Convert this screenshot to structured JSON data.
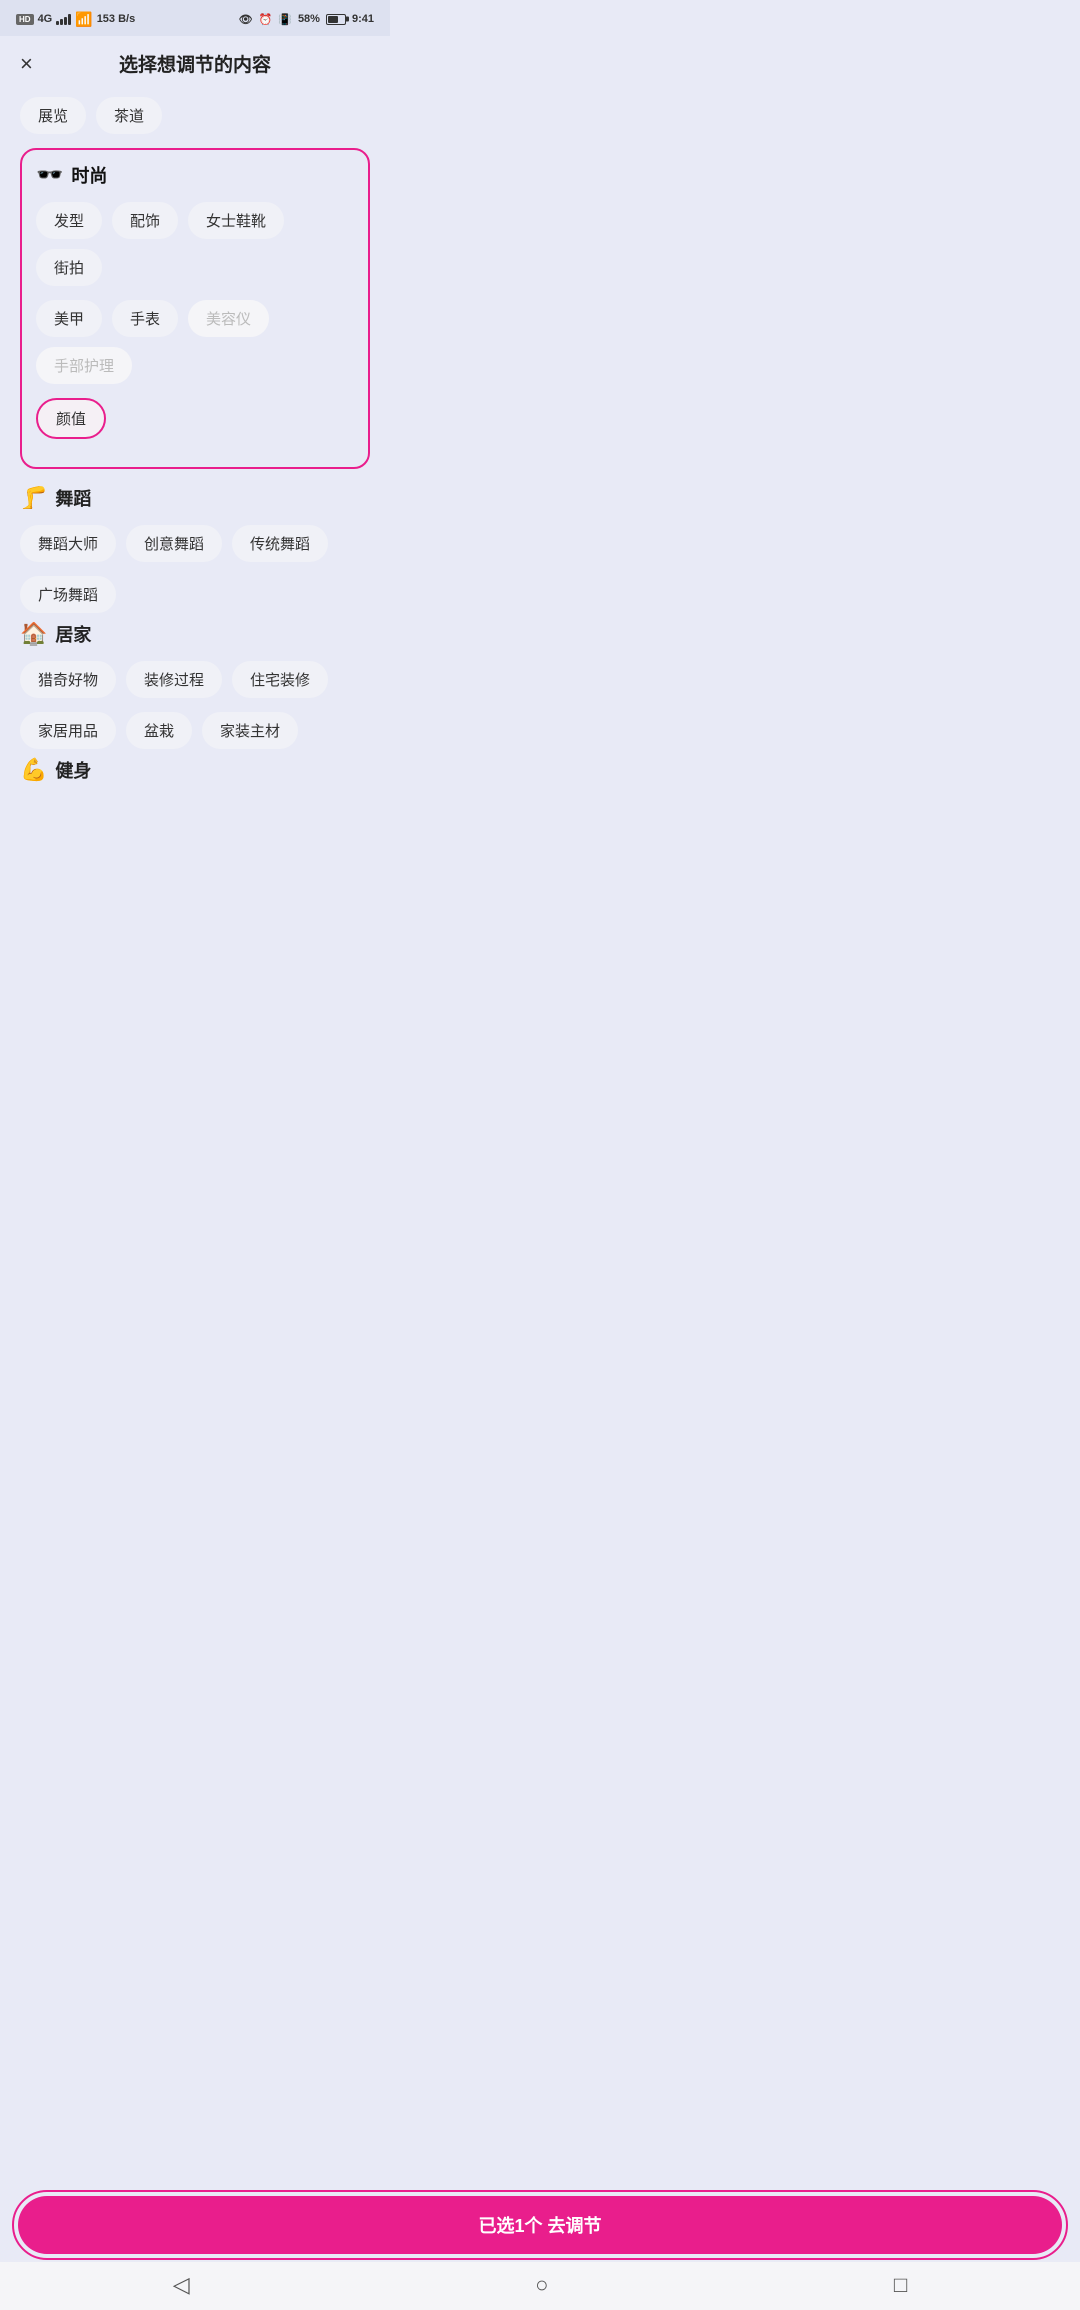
{
  "statusBar": {
    "hd": "HD",
    "signal4g": "4G",
    "network": "153 B/s",
    "battery_pct": "58%",
    "time": "9:41"
  },
  "header": {
    "title": "选择想调节的内容",
    "close_label": "×"
  },
  "topChips": [
    {
      "label": "展览",
      "id": "zhanlan"
    },
    {
      "label": "茶道",
      "id": "chadao"
    }
  ],
  "fashionSection": {
    "emoji": "🕶️",
    "name": "时尚",
    "chips": [
      {
        "label": "发型",
        "id": "faxing",
        "disabled": false
      },
      {
        "label": "配饰",
        "id": "peishi",
        "disabled": false
      },
      {
        "label": "女士鞋靴",
        "id": "nvshixuexue",
        "disabled": false
      },
      {
        "label": "街拍",
        "id": "jie-pai",
        "disabled": false
      },
      {
        "label": "美甲",
        "id": "meijia",
        "disabled": false
      },
      {
        "label": "手表",
        "id": "shubiao",
        "disabled": false
      },
      {
        "label": "美容仪",
        "id": "meirongyi",
        "disabled": true
      },
      {
        "label": "手部护理",
        "id": "shoubuhuli",
        "disabled": true
      }
    ],
    "selectedChip": {
      "label": "颜值",
      "id": "yanzhi"
    }
  },
  "danceSection": {
    "emoji": "🦵",
    "name": "舞蹈",
    "chips": [
      {
        "label": "舞蹈大师",
        "id": "wudaodashi"
      },
      {
        "label": "创意舞蹈",
        "id": "chuangyiwudao"
      },
      {
        "label": "传统舞蹈",
        "id": "chuantongwudao"
      },
      {
        "label": "广场舞蹈",
        "id": "guangchangwu"
      }
    ]
  },
  "homeSection": {
    "emoji": "🏠",
    "name": "居家",
    "chips": [
      {
        "label": "猎奇好物",
        "id": "lieqihaowu"
      },
      {
        "label": "装修过程",
        "id": "zhuangxiu"
      },
      {
        "label": "住宅装修",
        "id": "zhuzhaizhuangxiu"
      },
      {
        "label": "家居用品",
        "id": "jiajuyongpin"
      },
      {
        "label": "盆栽",
        "id": "penzai"
      },
      {
        "label": "家装主材",
        "id": "jiazhuangzhucai"
      }
    ]
  },
  "fitnessSection": {
    "emoji": "💪",
    "name": "健身"
  },
  "actionBtn": {
    "label": "已选1个 去调节"
  },
  "navBar": {
    "back": "◁",
    "home": "○",
    "square": "□"
  }
}
